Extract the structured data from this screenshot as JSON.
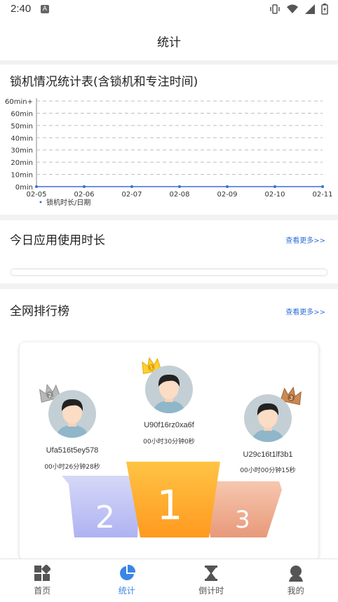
{
  "status": {
    "time": "2:40",
    "app_icon": "A"
  },
  "header": {
    "title": "统计"
  },
  "lock_chart": {
    "title": "锁机情况统计表(含锁机和专注时间)",
    "legend": "锁机时长/日期"
  },
  "chart_data": {
    "type": "line",
    "title": "锁机情况统计表(含锁机和专注时间)",
    "x": [
      "02-05",
      "02-06",
      "02-07",
      "02-08",
      "02-09",
      "02-10",
      "02-11"
    ],
    "y_ticks": [
      "0min",
      "10min",
      "20min",
      "30min",
      "40min",
      "50min",
      "60min",
      "60min+"
    ],
    "series": [
      {
        "name": "锁机时长/日期",
        "values": [
          0,
          0,
          0,
          0,
          0,
          0,
          0
        ]
      }
    ],
    "ylim": [
      0,
      70
    ],
    "grid": true,
    "legend_position": "bottom-left",
    "colors": {
      "line": "#3a6fd8",
      "grid": "#bdbdbd"
    }
  },
  "app_usage": {
    "title": "今日应用使用时长",
    "more": "查看更多>>",
    "progress": 0
  },
  "ranking": {
    "title": "全网排行榜",
    "more": "查看更多>>",
    "first": {
      "rank": "1",
      "name": "U90f16rz0xa6f",
      "time": "00小时30分钟0秒"
    },
    "second": {
      "rank": "2",
      "name": "Ufa516t5ey578",
      "time": "00小时26分钟28秒"
    },
    "third": {
      "rank": "3",
      "name": "U29c16t1lf3b1",
      "time": "00小时00分钟15秒"
    },
    "podium": {
      "first": "1",
      "second": "2",
      "third": "3"
    }
  },
  "tabs": [
    {
      "label": "首页",
      "icon": "home-grid-icon"
    },
    {
      "label": "统计",
      "icon": "pie-chart-icon"
    },
    {
      "label": "倒计时",
      "icon": "hourglass-icon"
    },
    {
      "label": "我的",
      "icon": "user-icon"
    }
  ]
}
